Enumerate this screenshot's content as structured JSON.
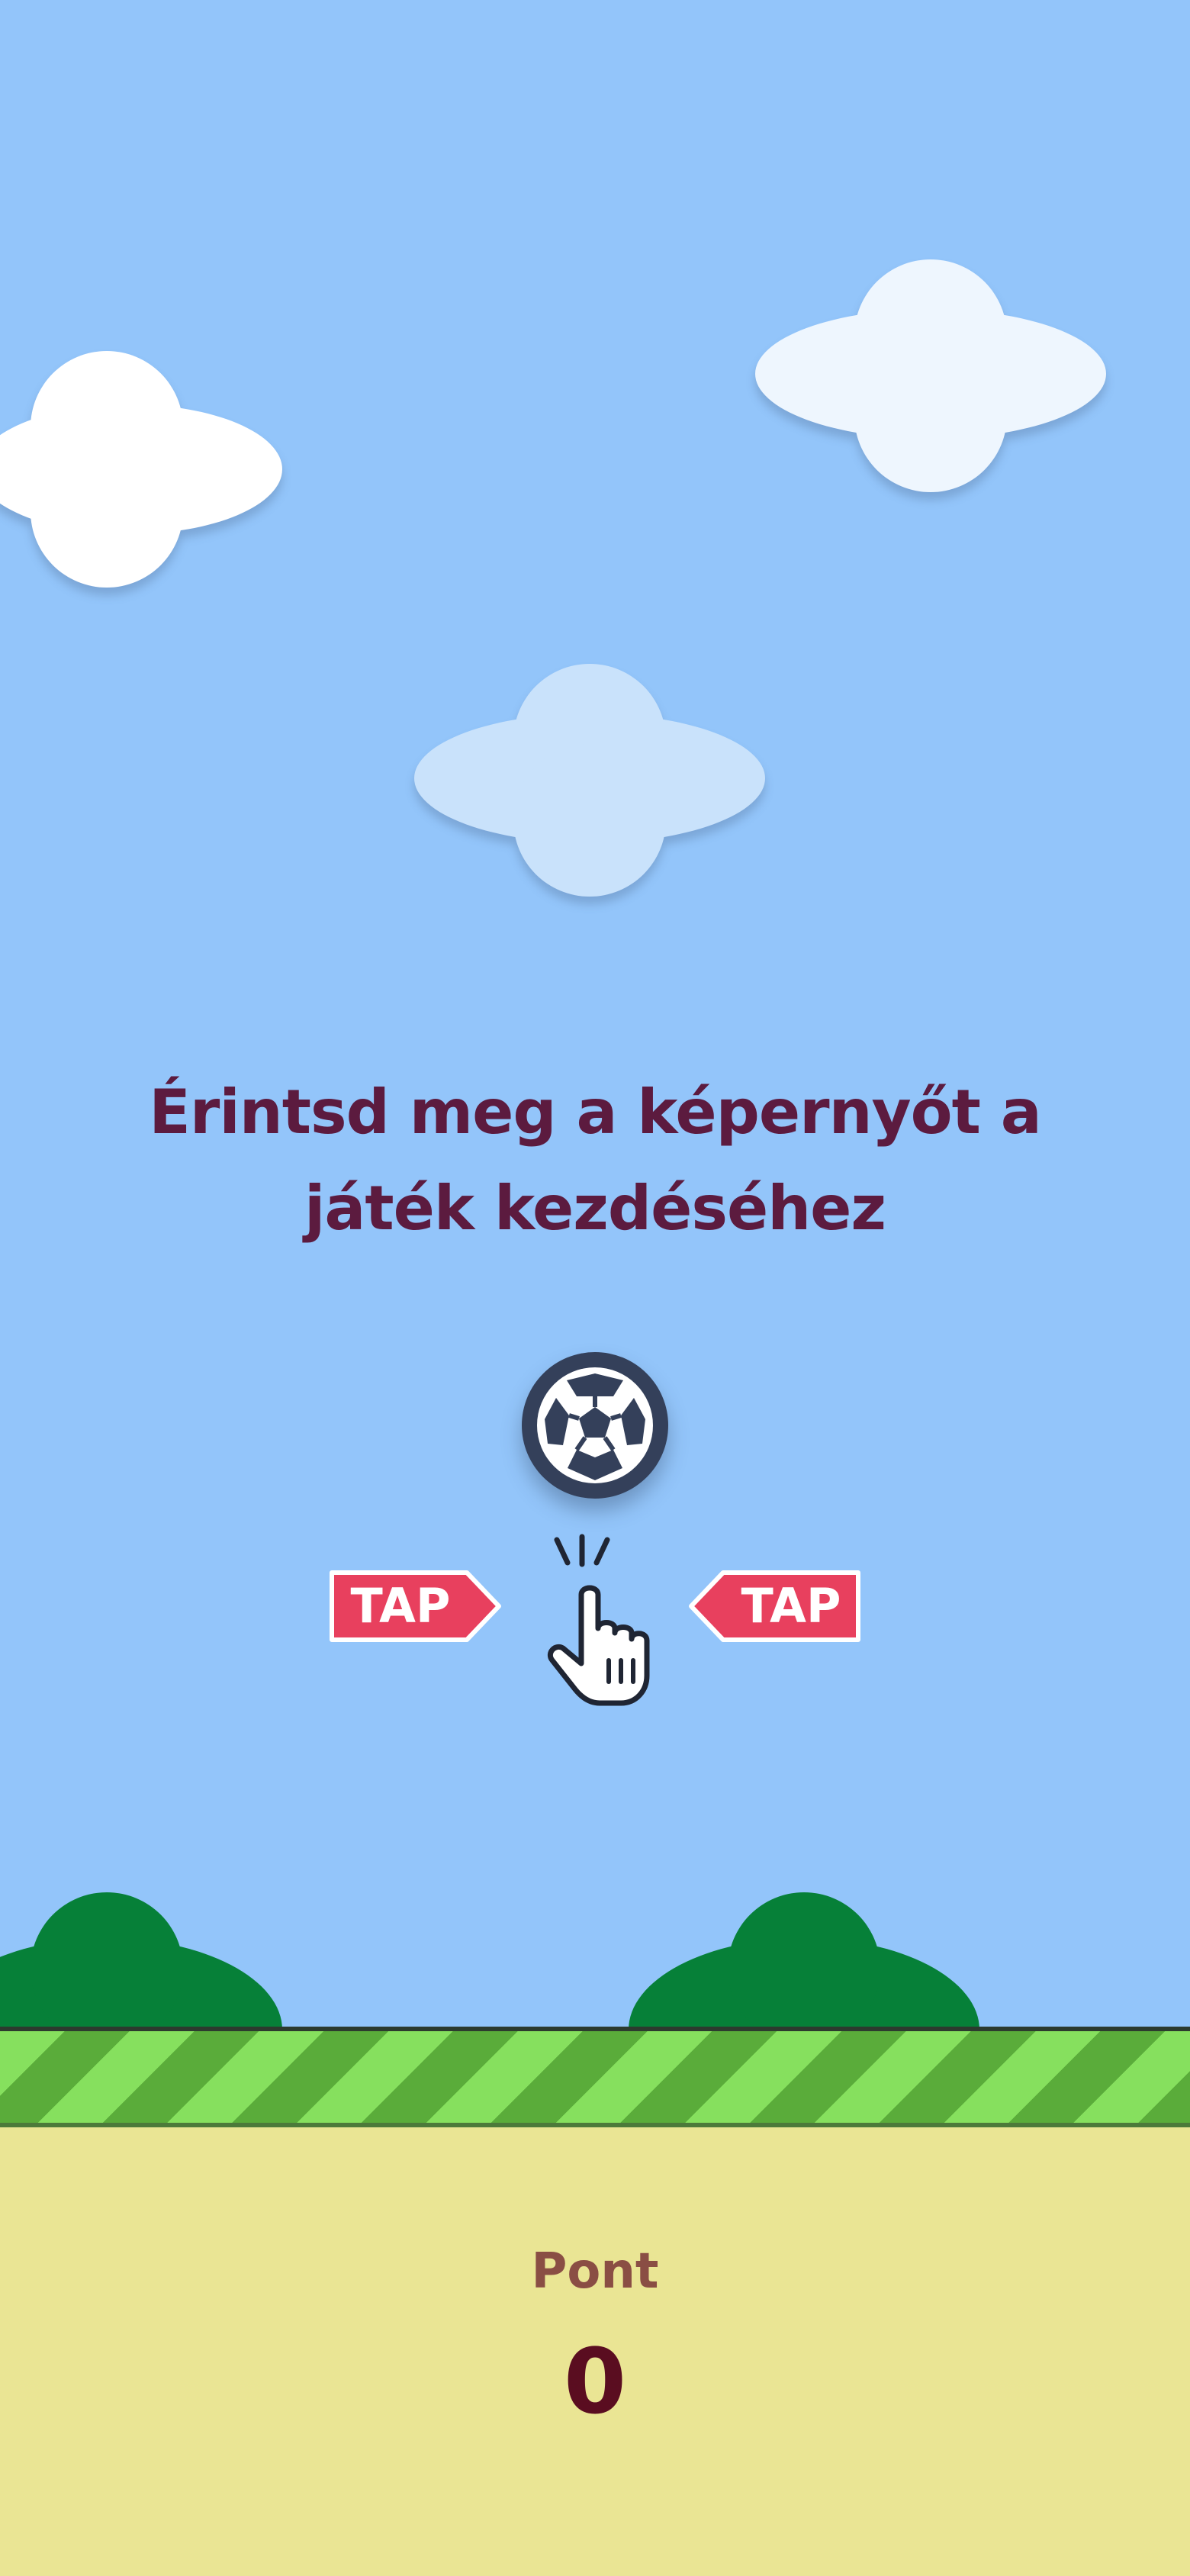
{
  "instruction": {
    "line1": "Érintsd meg a képernyőt a",
    "line2": "játék kezdéséhez"
  },
  "tap_hints": {
    "left_label": "TAP",
    "right_label": "TAP"
  },
  "score": {
    "label": "Pont",
    "value": "0"
  },
  "icons": {
    "player": "soccer-ball-icon",
    "pointer": "tapping-hand-icon"
  },
  "colors": {
    "sky": "#93c5fa",
    "title_text": "#5c1b3f",
    "tap_badge": "#e8405e",
    "ball_background": "#34405a",
    "grass_light": "#86e05e",
    "grass_dark": "#5aac3a",
    "bush": "#068038",
    "sand": "#eae594",
    "score_label": "#8a4e44",
    "score_value": "#5a0d20"
  }
}
